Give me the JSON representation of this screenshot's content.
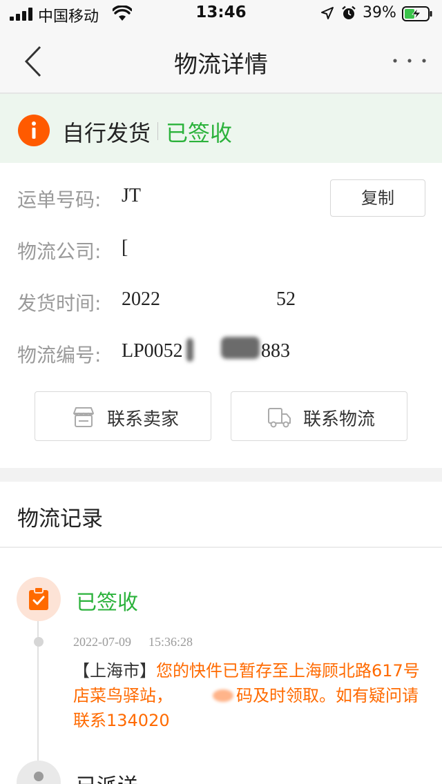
{
  "status_bar": {
    "carrier": "中国移动",
    "time": "13:46",
    "battery_percent": "39%"
  },
  "nav": {
    "title": "物流详情"
  },
  "banner": {
    "delivery_type": "自行发货",
    "status": "已签收"
  },
  "info": {
    "waybill_label": "运单号码:",
    "waybill_value": "JT",
    "copy_label": "复制",
    "company_label": "物流公司:",
    "company_value": "[",
    "ship_time_label": "发货时间:",
    "ship_time_prefix": "2022",
    "ship_time_suffix": "52",
    "logistics_no_label": "物流编号:",
    "logistics_no_prefix": "LP0052",
    "logistics_no_suffix": "883"
  },
  "actions": {
    "contact_seller": "联系卖家",
    "contact_logistics": "联系物流"
  },
  "records": {
    "title": "物流记录",
    "items": [
      {
        "status": "已签收",
        "date": "2022-07-09",
        "time": "15:36:28",
        "city": "【上海市】",
        "msg_line1": "您的快件已暂存至上海顾北路617号",
        "msg_line2_a": "店菜鸟驿站，",
        "msg_line2_b": "码及时领取。如有疑问请",
        "msg_line3": "联系134020"
      },
      {
        "status": "已派送"
      }
    ]
  },
  "colors": {
    "accent_green": "#2bb23b",
    "accent_orange": "#ff6a00",
    "banner_bg": "#edf6ee"
  }
}
